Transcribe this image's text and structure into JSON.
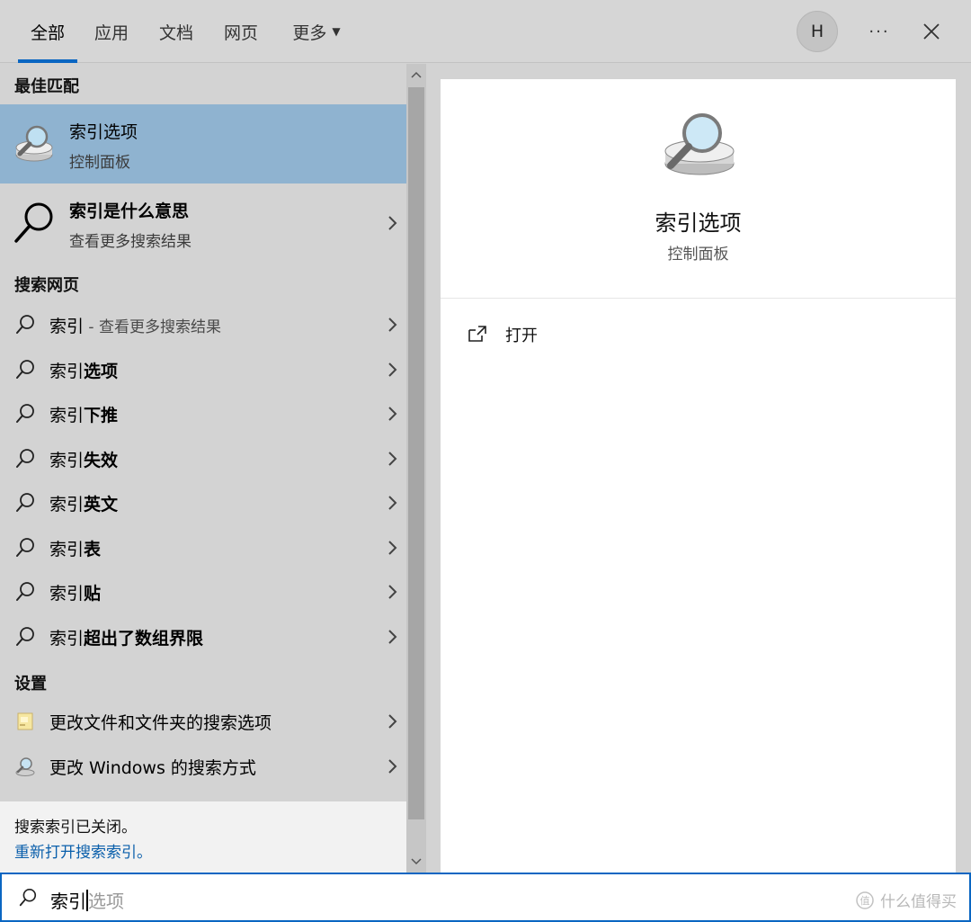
{
  "tabs": [
    {
      "label": "全部",
      "active": true
    },
    {
      "label": "应用"
    },
    {
      "label": "文档"
    },
    {
      "label": "网页"
    },
    {
      "label": "更多"
    }
  ],
  "header": {
    "avatar_letter": "H",
    "more_label": "···"
  },
  "best_match": {
    "section_title": "最佳匹配",
    "title": "索引选项",
    "subtitle": "控制面板",
    "icon": "indexing-options-icon"
  },
  "web_result": {
    "title": "索引是什么意思",
    "subtitle": "查看更多搜索结果",
    "icon": "magnifier-icon"
  },
  "web_section": {
    "title": "搜索网页",
    "items": [
      {
        "prefix": "索引",
        "rest": "",
        "hint": " - 查看更多搜索结果"
      },
      {
        "prefix": "索引",
        "rest": "选项",
        "hint": ""
      },
      {
        "prefix": "索引",
        "rest": "下推",
        "hint": ""
      },
      {
        "prefix": "索引",
        "rest": "失效",
        "hint": ""
      },
      {
        "prefix": "索引",
        "rest": "英文",
        "hint": ""
      },
      {
        "prefix": "索引",
        "rest": "表",
        "hint": ""
      },
      {
        "prefix": "索引",
        "rest": "贴",
        "hint": ""
      },
      {
        "prefix": "索引",
        "rest": "超出了数组界限",
        "hint": ""
      }
    ]
  },
  "settings_section": {
    "title": "设置",
    "items": [
      {
        "label": "更改文件和文件夹的搜索选项",
        "icon": "folder-options-icon"
      },
      {
        "label": "更改 Windows 的搜索方式",
        "icon": "search-settings-icon"
      }
    ]
  },
  "notice": {
    "line1": "搜索索引已关闭。",
    "link": "重新打开搜索索引。"
  },
  "detail": {
    "title": "索引选项",
    "subtitle": "控制面板",
    "action_label": "打开"
  },
  "search": {
    "typed": "索引",
    "suggestion": "选项"
  },
  "watermark": "什么值得买",
  "colors": {
    "accent": "#0a66c2",
    "selected_row": "#8fb3d0",
    "link": "#0a5fab"
  }
}
